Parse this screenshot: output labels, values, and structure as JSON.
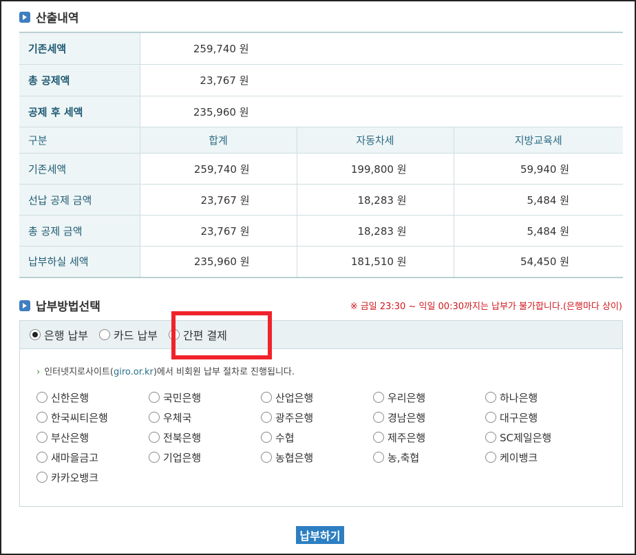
{
  "section1": {
    "title": "산출내역"
  },
  "summary": [
    {
      "label": "기존세액",
      "amount": "259,740",
      "unit": "원"
    },
    {
      "label": "총 공제액",
      "amount": "23,767",
      "unit": "원"
    },
    {
      "label": "공제 후 세액",
      "amount": "235,960",
      "unit": "원"
    }
  ],
  "detail": {
    "headers": [
      "구분",
      "합계",
      "자동차세",
      "지방교육세"
    ],
    "rows": [
      {
        "label": "기존세액",
        "total": "259,740 원",
        "car_tax": "199,800 원",
        "edu_tax": "59,940 원"
      },
      {
        "label": "선납 공제 금액",
        "total": "23,767 원",
        "car_tax": "18,283 원",
        "edu_tax": "5,484 원"
      },
      {
        "label": "총 공제 금액",
        "total": "23,767 원",
        "car_tax": "18,283 원",
        "edu_tax": "5,484 원"
      },
      {
        "label": "납부하실 세액",
        "total": "235,960 원",
        "car_tax": "181,510 원",
        "edu_tax": "54,450 원"
      }
    ]
  },
  "section2": {
    "title": "납부방법선택",
    "notice": "※ 금일 23:30 ~ 익일 00:30까지는 납부가 불가합니다.(은행마다 상이)"
  },
  "tabs": [
    {
      "label": "은행 납부",
      "selected": true
    },
    {
      "label": "카드 납부",
      "selected": false
    },
    {
      "label": "간편 결제",
      "selected": false
    }
  ],
  "info": {
    "prefix": "인터넷지로사이트(",
    "site": "giro.or.kr",
    "suffix": ")에서 비회원 납부 절차로 진행됩니다."
  },
  "banks": [
    "신한은행",
    "국민은행",
    "산업은행",
    "우리은행",
    "하나은행",
    "한국씨티은행",
    "우체국",
    "광주은행",
    "경남은행",
    "대구은행",
    "부산은행",
    "전북은행",
    "수협",
    "제주은행",
    "SC제일은행",
    "새마을금고",
    "기업은행",
    "농협은행",
    "농,축협",
    "케이뱅크",
    "카카오뱅크"
  ],
  "actions": {
    "pay_label": "납부하기"
  },
  "colors": {
    "accent": "#2d7fc2",
    "highlight": "#f0232a",
    "notice": "#d0161a",
    "label_bg": "#eef5f6"
  }
}
